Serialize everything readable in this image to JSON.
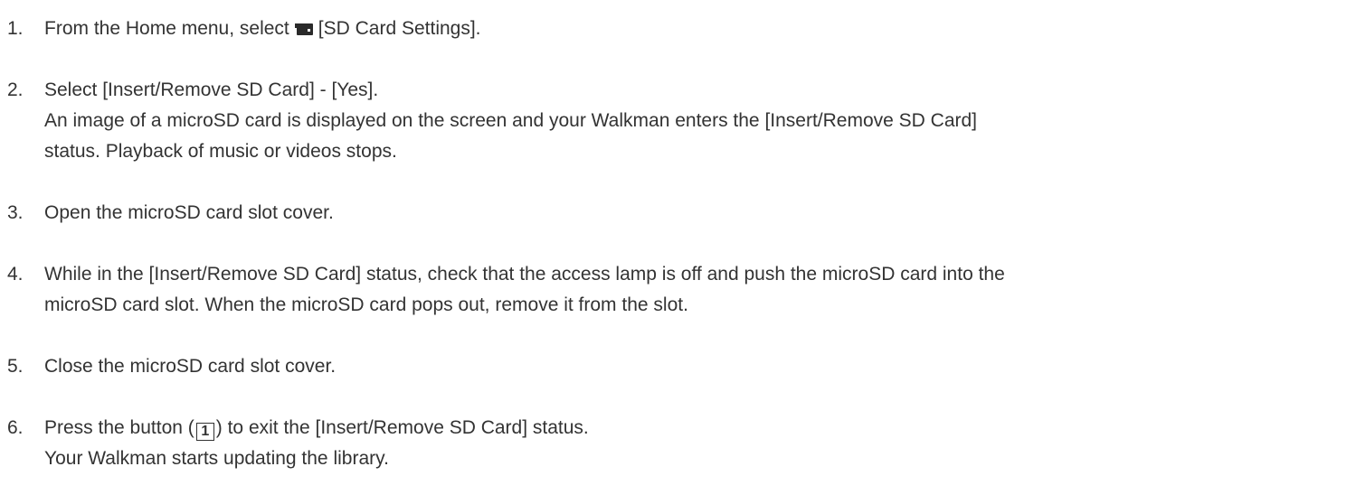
{
  "steps": [
    {
      "number": "1.",
      "text_before_icon": "From the Home menu, select",
      "icon": "sd-card-icon",
      "text_after_icon": "[SD Card Settings]."
    },
    {
      "number": "2.",
      "text": "Select [Insert/Remove SD Card] - [Yes].",
      "detail_line1": "An image of a microSD card is displayed on the screen and your Walkman enters the [Insert/Remove SD Card]",
      "detail_line2": "status. Playback of music or videos stops."
    },
    {
      "number": "3.",
      "text": "Open the microSD card slot cover."
    },
    {
      "number": "4.",
      "line1": "While in the [Insert/Remove SD Card] status, check that the access lamp is off and push the microSD card into the",
      "line2": "microSD card slot. When the microSD card pops out, remove it from the slot."
    },
    {
      "number": "5.",
      "text": "Close the microSD card slot cover."
    },
    {
      "number": "6.",
      "text_before_box": "Press the button (",
      "box_label": "1",
      "text_after_box": ") to exit the [Insert/Remove SD Card] status.",
      "detail": "Your Walkman starts updating the library."
    }
  ]
}
